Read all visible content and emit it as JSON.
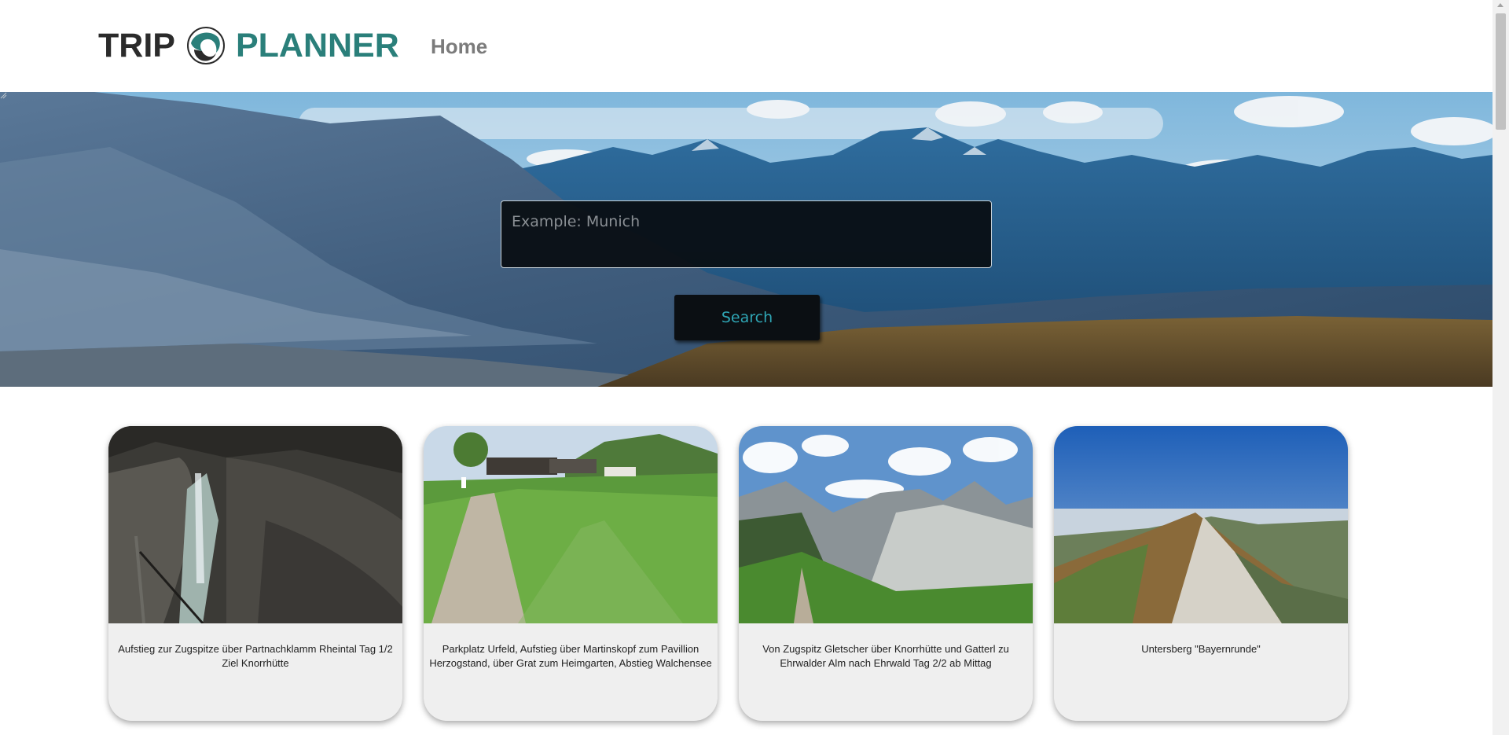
{
  "header": {
    "logo_trip": "TRIP",
    "logo_planner": "PLANNER",
    "nav_home": "Home"
  },
  "search": {
    "placeholder": "Example: Munich",
    "value": "",
    "button_label": "Search"
  },
  "cards": [
    {
      "title": "Aufstieg zur Zugspitze über Partnachklamm Rheintal Tag 1/2 Ziel Knorrhütte"
    },
    {
      "title": "Parkplatz Urfeld, Aufstieg über Martinskopf zum Pavillion Herzogstand, über Grat zum Heimgarten, Abstieg Walchensee"
    },
    {
      "title": "Von Zugspitz Gletscher über Knorrhütte und Gatterl zu Ehrwalder Alm nach Ehrwald Tag 2/2 ab Mittag"
    },
    {
      "title": "Untersberg \"Bayernrunde\""
    }
  ],
  "colors": {
    "brand_teal": "#2a7f7a",
    "logo_dark": "#2b2b2b",
    "nav_gray": "#7b7b7b",
    "search_button_text": "#2fa6b5",
    "card_bg": "#efefef"
  },
  "icons": {
    "logo_mark": "wave-logo-icon"
  }
}
